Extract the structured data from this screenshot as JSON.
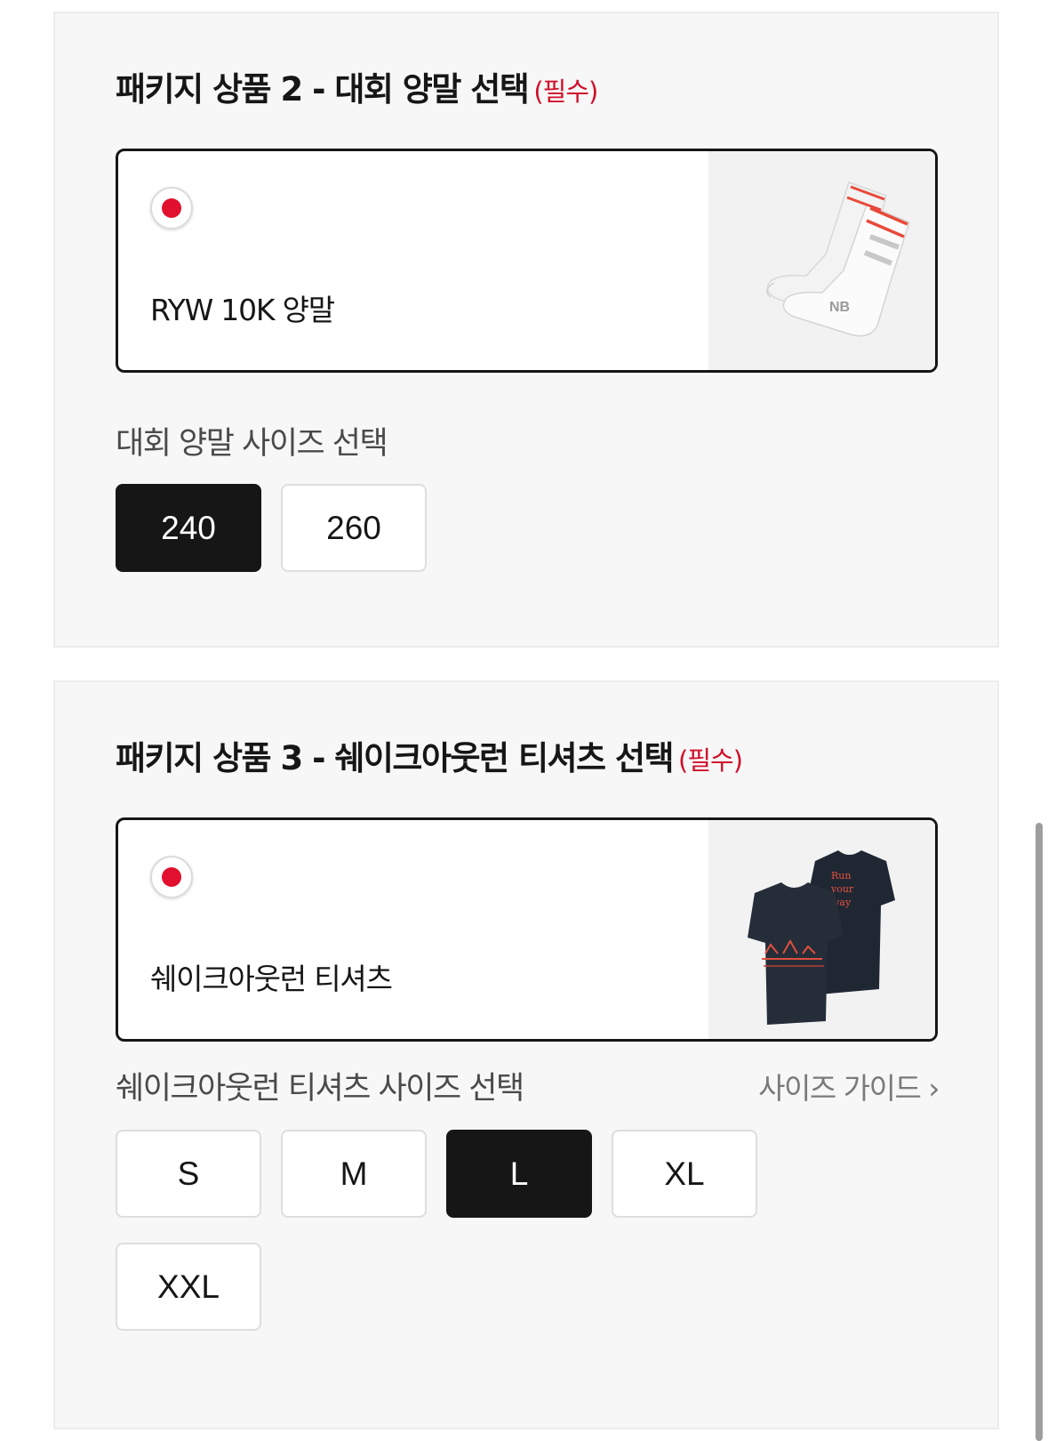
{
  "package2": {
    "title": "패키지 상품 2 - 대회 양말 선택",
    "required": "(필수)",
    "product": {
      "name": "RYW 10K 양말",
      "selected": true
    },
    "size_label": "대회 양말 사이즈 선택",
    "sizes": [
      {
        "label": "240",
        "selected": true
      },
      {
        "label": "260",
        "selected": false
      }
    ]
  },
  "package3": {
    "title": "패키지 상품 3 - 쉐이크아웃런 티셔츠 선택",
    "required": "(필수)",
    "product": {
      "name": "쉐이크아웃런 티셔츠",
      "selected": true
    },
    "size_label": "쉐이크아웃런 티셔츠 사이즈 선택",
    "size_guide": "사이즈 가이드 ›",
    "sizes": [
      {
        "label": "S",
        "selected": false
      },
      {
        "label": "M",
        "selected": false
      },
      {
        "label": "L",
        "selected": true
      },
      {
        "label": "XL",
        "selected": false
      },
      {
        "label": "XXL",
        "selected": false
      }
    ]
  },
  "colors": {
    "accent_red": "#e0102e",
    "selected_bg": "#161616",
    "section_bg": "#f7f7f7"
  }
}
